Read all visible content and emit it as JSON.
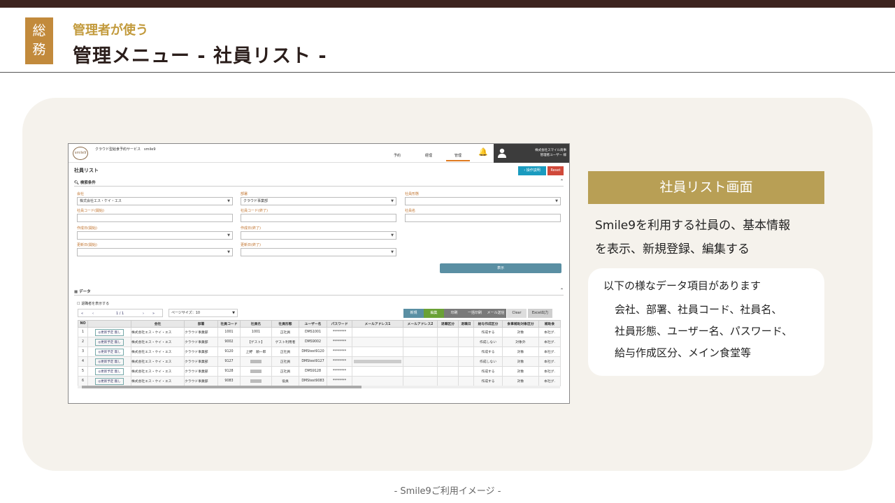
{
  "header": {
    "badge": [
      "総",
      "務"
    ],
    "subtitle": "管理者が使う",
    "title": "管理メニュー - 社員リスト -"
  },
  "app": {
    "logo": "smile9",
    "app_name": "クラウド型給食予約サービス　smile9",
    "nav": [
      "予約",
      "経理",
      "管理"
    ],
    "nav_active": "管理",
    "company": "株式会社スマイル商事",
    "user": "管理者ユーザー 様",
    "page_title": "社員リスト",
    "help_button": "‹ 操作説明",
    "reset_button": "Reset",
    "search": {
      "header": "検索条件",
      "fields": [
        {
          "label": "会社",
          "value": "株式会社エス・ケイ・エス",
          "dropdown": true
        },
        {
          "label": "部署",
          "value": "クラウド事業部",
          "dropdown": true
        },
        {
          "label": "社員形態",
          "value": "",
          "dropdown": true
        },
        {
          "label": "社員コード(開始)",
          "value": "",
          "dropdown": false
        },
        {
          "label": "社員コード(終了)",
          "value": "",
          "dropdown": false
        },
        {
          "label": "社員名",
          "value": "",
          "dropdown": false
        },
        {
          "label": "作成日(開始)",
          "value": "",
          "dropdown": true
        },
        {
          "label": "作成日(終了)",
          "value": "",
          "dropdown": true
        },
        {
          "label": "更新日(開始)",
          "value": "",
          "dropdown": true
        },
        {
          "label": "更新日(終了)",
          "value": "",
          "dropdown": true
        }
      ],
      "show_button": "表示"
    },
    "data": {
      "header": "データ",
      "show_retired": "退職者を表示する",
      "pager": {
        "first": "«",
        "prev": "‹",
        "page": "1 / 1",
        "next": "›",
        "last": "»"
      },
      "page_size": "ページサイズ：10",
      "actions": [
        {
          "label": "新規",
          "color": "#5a8fa3"
        },
        {
          "label": "編集",
          "color": "#6aa136"
        },
        {
          "label": "印刷",
          "color": "#7a7a7a"
        },
        {
          "label": "一括印刷",
          "color": "#7a7a7a"
        },
        {
          "label": "メール送信",
          "color": "#7a7a7a"
        },
        {
          "label": "Clear",
          "color": "#dddddd"
        },
        {
          "label": "Excel出力",
          "color": "#cfcfcf"
        }
      ],
      "columns": [
        "NO",
        "",
        "会社",
        "部署",
        "社員コード",
        "社員名",
        "社員形態",
        "ユーザー名",
        "パスワード",
        "メールアドレス1",
        "メールアドレス2",
        "退職区分",
        "退職日",
        "給与作成区分",
        "食事補助対象区分",
        "補助食"
      ],
      "row_button": "◎更新予定 無し",
      "rows": [
        {
          "no": "1",
          "company": "株式会社エス・ケイ・エス",
          "dept": "クラウド事業部",
          "code": "1001",
          "name": "1001",
          "name_blur": false,
          "type": "正社員",
          "user": "DMS1001",
          "pw": "********",
          "mail1_blur": false,
          "salary": "作成する",
          "meal": "対象",
          "sub": "本社グ."
        },
        {
          "no": "2",
          "company": "株式会社エス・ケイ・エス",
          "dept": "クラウド事業部",
          "code": "9002",
          "name": "【ゲスト】",
          "name_blur": false,
          "type": "ゲスト利用者",
          "user": "DMS9002",
          "pw": "********",
          "mail1_blur": false,
          "salary": "作成しない",
          "meal": "対象外",
          "sub": "本社グ."
        },
        {
          "no": "3",
          "company": "株式会社エス・ケイ・エス",
          "dept": "クラウド事業部",
          "code": "9120",
          "name": "上野　順一郎",
          "name_blur": false,
          "type": "正社員",
          "user": "DMStest9120",
          "pw": "********",
          "mail1_blur": false,
          "salary": "作成する",
          "meal": "対象",
          "sub": "本社グ."
        },
        {
          "no": "4",
          "company": "株式会社エス・ケイ・エス",
          "dept": "クラウド事業部",
          "code": "9127",
          "name": "",
          "name_blur": true,
          "type": "正社員",
          "user": "DMStest9127",
          "pw": "********",
          "mail1_blur": true,
          "salary": "作成しない",
          "meal": "対象",
          "sub": "本社グ."
        },
        {
          "no": "5",
          "company": "株式会社エス・ケイ・エス",
          "dept": "クラウド事業部",
          "code": "9128",
          "name": "",
          "name_blur": true,
          "type": "正社員",
          "user": "DMS9128",
          "pw": "********",
          "mail1_blur": false,
          "salary": "作成する",
          "meal": "対象",
          "sub": "本社グ."
        },
        {
          "no": "6",
          "company": "株式会社エス・ケイ・エス",
          "dept": "クラウド事業部",
          "code": "9083",
          "name": "",
          "name_blur": true,
          "type": "役員",
          "user": "DMStest9083",
          "pw": "********",
          "mail1_blur": false,
          "salary": "作成する",
          "meal": "対象",
          "sub": "本社グ."
        }
      ]
    }
  },
  "callout": {
    "banner": "社員リスト画面",
    "description": [
      "Smile9を利用する社員の、基本情報",
      "を表示、新規登録、編集する"
    ],
    "list_header": "以下の様なデータ項目があります",
    "list_lines": [
      "会社、部署、社員コード、社員名、",
      "社員形態、ユーザー名、パスワード、",
      "給与作成区分、メイン食堂等"
    ]
  },
  "footer": "- Smile9ご利用イメージ -"
}
